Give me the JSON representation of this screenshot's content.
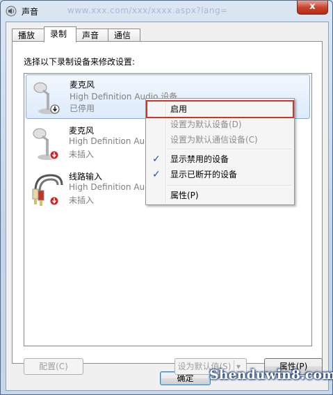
{
  "window": {
    "title": "声音",
    "title_watermark": "www.xxx.com/xxx/xxxx.aspx?lang=",
    "close_label": "x"
  },
  "tabs": [
    {
      "label": "播放"
    },
    {
      "label": "录制",
      "active": true
    },
    {
      "label": "声音"
    },
    {
      "label": "通信"
    }
  ],
  "instruction": "选择以下录制设备来修改设置:",
  "devices": [
    {
      "name": "麦克风",
      "desc": "High Definition Audio 设备",
      "status": "已停用",
      "icon": "microphone-icon",
      "badge": "disabled-badge-icon"
    },
    {
      "name": "麦克风",
      "desc": "High Definition Audio",
      "status": "未插入",
      "icon": "microphone-icon",
      "badge": "unplugged-badge-icon"
    },
    {
      "name": "线路输入",
      "desc": "High Definition Audio",
      "status": "未插入",
      "icon": "line-in-cable-icon",
      "badge": "unplugged-badge-icon"
    }
  ],
  "context_menu": {
    "items": [
      {
        "label": "启用",
        "enabled": true,
        "highlighted": true
      },
      {
        "label": "设置为默认设备(D)",
        "enabled": false
      },
      {
        "label": "设置为默认通信设备(C)",
        "enabled": false
      },
      {
        "label": "显示禁用的设备",
        "checked": true
      },
      {
        "label": "显示已断开的设备",
        "checked": true
      },
      {
        "label": "属性(P)"
      }
    ]
  },
  "buttons": {
    "configure": "配置(C)",
    "set_default": "设为默认值(S)",
    "properties": "属性(P)",
    "ok": "确定"
  },
  "watermark": "Shenduwin8.com",
  "colors": {
    "highlight_border": "#d5302a",
    "selection_bg": "#dcebfc",
    "window_frame": "#c4d4e8"
  }
}
